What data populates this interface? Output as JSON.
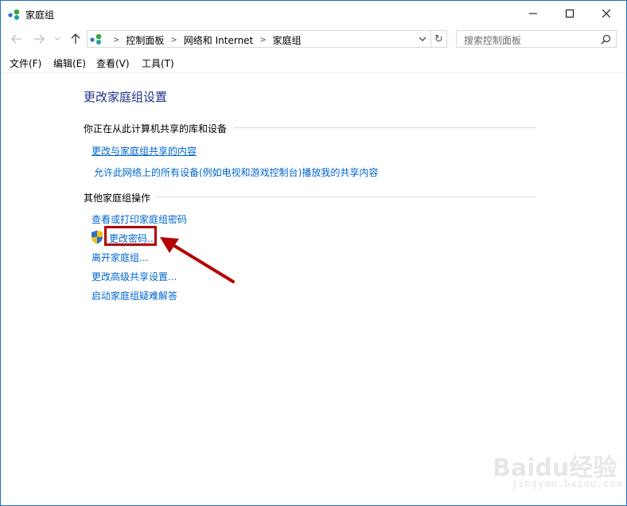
{
  "window": {
    "title": "家庭组",
    "controls": {
      "minimize_icon": "minimize-icon",
      "maximize_icon": "maximize-icon",
      "close_icon": "close-icon"
    }
  },
  "navigation": {
    "breadcrumbs": [
      "控制面板",
      "网络和 Internet",
      "家庭组"
    ],
    "search_placeholder": "搜索控制面板"
  },
  "menubar": {
    "items": [
      "文件(F)",
      "编辑(E)",
      "查看(V)",
      "工具(T)"
    ]
  },
  "main": {
    "title": "更改家庭组设置",
    "sections": [
      {
        "heading": "你正在从此计算机共享的库和设备",
        "links": [
          "更改与家庭组共享的内容",
          "允许此网络上的所有设备(例如电视和游戏控制台)播放我的共享内容"
        ]
      },
      {
        "heading": "其他家庭组操作",
        "links": [
          "查看或打印家庭组密码",
          "更改密码...",
          "离开家庭组...",
          "更改高级共享设置...",
          "启动家庭组疑难解答"
        ]
      }
    ]
  },
  "annotation": {
    "color": "#b30000"
  },
  "watermark": {
    "logo": "Baidu经验",
    "url": "jingyan.baidu.com"
  },
  "colors": {
    "link": "#0066cc",
    "title": "#1e3287",
    "window_border": "#1a6fc4"
  }
}
